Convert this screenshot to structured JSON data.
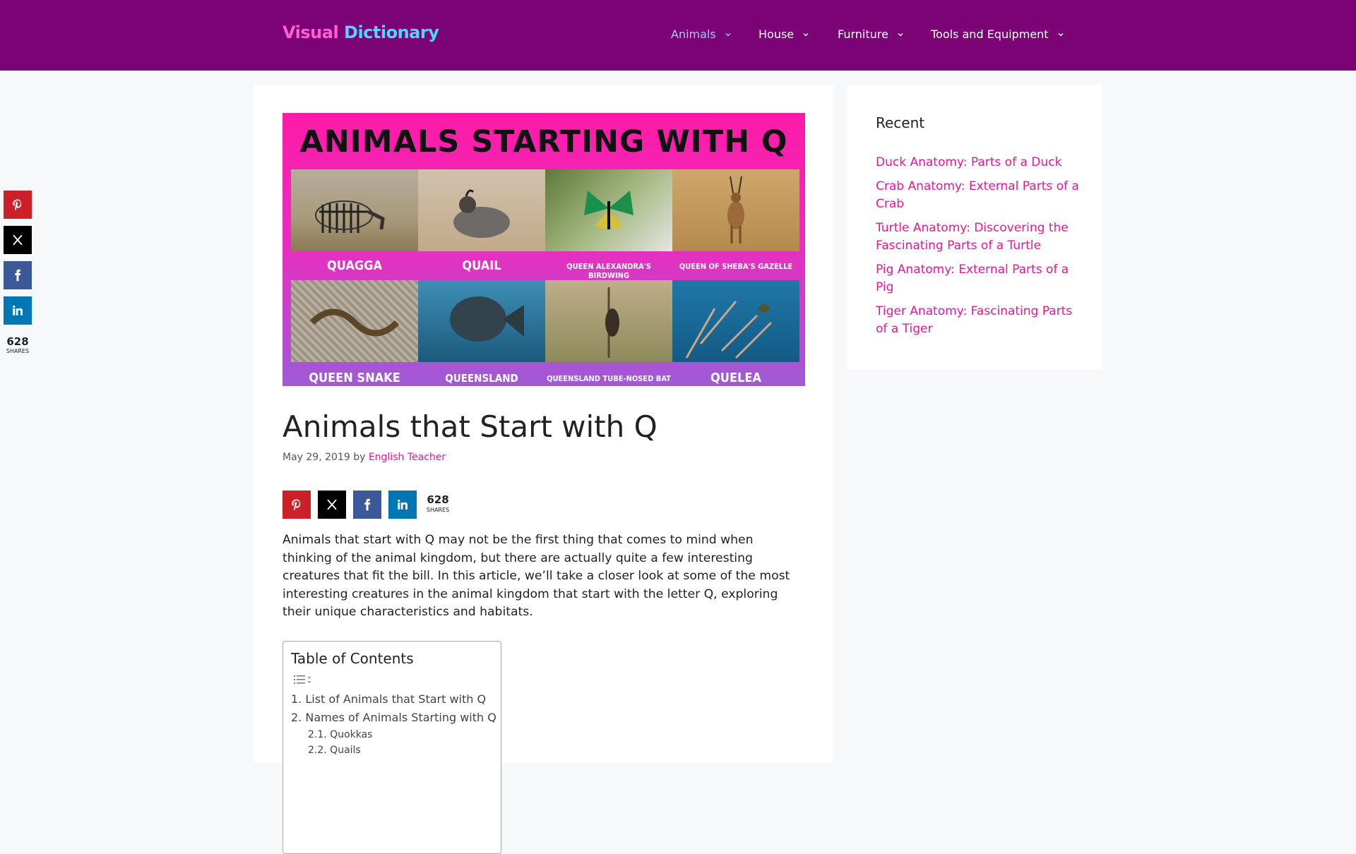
{
  "header": {
    "logo_part1": "Visual",
    "logo_part2": "Dictionary",
    "nav": [
      {
        "label": "Animals"
      },
      {
        "label": "House"
      },
      {
        "label": "Furniture"
      },
      {
        "label": "Tools and Equipment"
      }
    ]
  },
  "hero": {
    "title": "ANIMALS STARTING WITH Q",
    "tiles": [
      {
        "label": "QUAGGA",
        "icon": "zebra-photo"
      },
      {
        "label": "QUAIL",
        "icon": "quail-photo"
      },
      {
        "label": "QUEEN ALEXANDRA'S BIRDWING",
        "icon": "butterfly-photo"
      },
      {
        "label": "QUEEN OF SHEBA'S GAZELLE",
        "icon": "gazelle-photo"
      },
      {
        "label": "QUEEN SNAKE",
        "icon": "snake-photo"
      },
      {
        "label": "QUEENSLAND GROUPER",
        "icon": "grouper-photo"
      },
      {
        "label": "QUEENSLAND TUBE-NOSED BAT",
        "icon": "bat-photo"
      },
      {
        "label": "QUELEA",
        "icon": "quelea-photo"
      }
    ]
  },
  "post": {
    "title": "Animals that Start with Q",
    "date": "May 29, 2019",
    "by": "by",
    "author": "English Teacher",
    "intro": "Animals that start with Q may not be the first thing that comes to mind when thinking of the animal kingdom, but there are actually quite a few interesting creatures that fit the bill. In this article, we’ll take a closer look at some of the most interesting creatures in the animal kingdom that start with the letter Q, exploring their unique characteristics and habitats."
  },
  "share": {
    "count": "628",
    "label": "SHARES",
    "colors": {
      "pinterest": "#cb2027",
      "x": "#000000",
      "facebook": "#3b5998",
      "linkedin": "#0077b5"
    }
  },
  "toc": {
    "title": "Table of Contents",
    "items": [
      {
        "num": "1.",
        "label": "List of Animals that Start with Q"
      },
      {
        "num": "2.",
        "label": "Names of Animals Starting with Q"
      },
      {
        "num": "2.1.",
        "label": "Quokkas"
      },
      {
        "num": "2.2.",
        "label": "Quails"
      }
    ]
  },
  "sidebar": {
    "title": "Recent",
    "recent": [
      "Duck Anatomy: Parts of a Duck",
      "Crab Anatomy: External Parts of a Crab",
      "Turtle Anatomy: Discovering the Fascinating Parts of a Turtle",
      "Pig Anatomy: External Parts of a Pig",
      "Tiger Anatomy: Fascinating Parts of a Tiger"
    ]
  },
  "colors": {
    "header_bg": "#7b0376",
    "link": "#e5179b",
    "nav_active": "#a8c7ff"
  }
}
